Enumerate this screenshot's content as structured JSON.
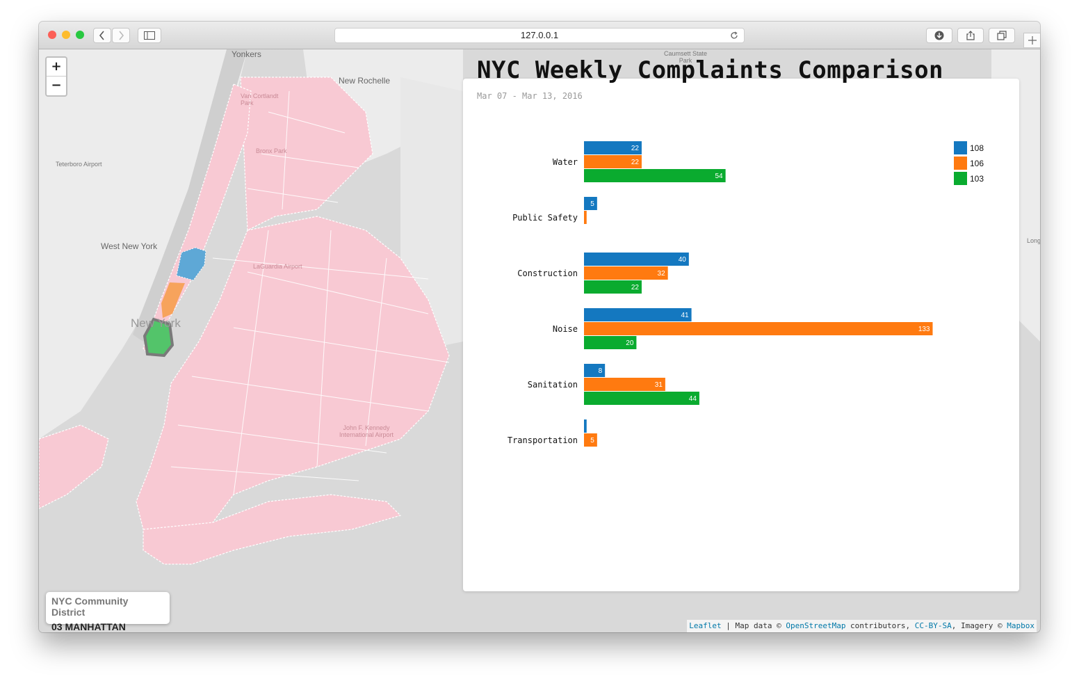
{
  "browser": {
    "url": "127.0.0.1"
  },
  "map": {
    "zoom_in": "+",
    "zoom_out": "−",
    "labels": {
      "yonkers": "Yonkers",
      "new_rochelle": "New Rochelle",
      "caumsett": "Caumsett State Park",
      "van_cortlandt": "Van Cortlandt Park",
      "bronx_park": "Bronx Park",
      "teterboro": "Teterboro Airport",
      "west_new_york": "West New York",
      "laguardia": "LaGuardia Airport",
      "new_york": "New York",
      "jfk": "John F. Kennedy International Airport",
      "long": "Long"
    },
    "district_box": {
      "title": "NYC Community District",
      "value": "03 MANHATTAN"
    },
    "attribution": {
      "leaflet": "Leaflet",
      "sep": " | ",
      "map_data": "Map data © ",
      "osm": "OpenStreetMap",
      "contributors": " contributors, ",
      "license": "CC-BY-SA",
      "imagery": ", Imagery © ",
      "mapbox": "Mapbox"
    }
  },
  "colors": {
    "series_108": "#1478c0",
    "series_106": "#ff7a10",
    "series_103": "#0aab2f",
    "district_pink": "#f8c9d3"
  },
  "chart_data": {
    "type": "bar",
    "orientation": "horizontal",
    "title": "NYC Weekly Complaints Comparison",
    "subtitle": "Mar 07 - Mar 13, 2016",
    "categories": [
      "Water",
      "Public Safety",
      "Construction",
      "Noise",
      "Sanitation",
      "Transportation"
    ],
    "series": [
      {
        "name": "108",
        "color": "#1478c0",
        "values": [
          22,
          5,
          40,
          41,
          8,
          1
        ]
      },
      {
        "name": "106",
        "color": "#ff7a10",
        "values": [
          22,
          1,
          32,
          133,
          31,
          5
        ]
      },
      {
        "name": "103",
        "color": "#0aab2f",
        "values": [
          54,
          0,
          22,
          20,
          44,
          0
        ]
      }
    ],
    "xlim": [
      0,
      140
    ],
    "legend_position": "top-right",
    "grid": false
  }
}
